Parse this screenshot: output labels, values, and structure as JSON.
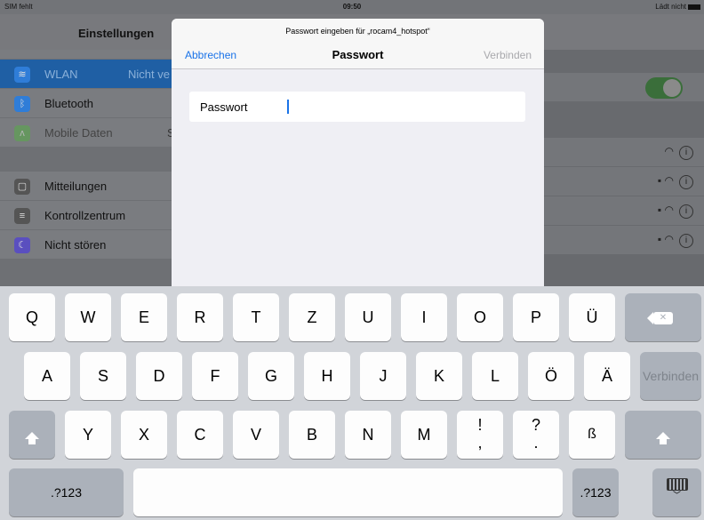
{
  "status_bar": {
    "carrier": "SIM fehlt",
    "time": "09:50",
    "battery_text": "Lädt nicht"
  },
  "settings": {
    "title": "Einstellungen",
    "items": [
      {
        "label": "WLAN",
        "value": "Nicht ve",
        "icon": "wifi-icon",
        "color": "#2f7dd8"
      },
      {
        "label": "Bluetooth",
        "value": "",
        "icon": "bluetooth-icon",
        "color": "#2f7dd8"
      },
      {
        "label": "Mobile Daten",
        "value": "S",
        "icon": "antenna-icon",
        "color": "#5aa84c"
      },
      {
        "label": "Mitteilungen",
        "value": "",
        "icon": "notifications-icon",
        "color": "#666"
      },
      {
        "label": "Kontrollzentrum",
        "value": "",
        "icon": "control-center-icon",
        "color": "#666"
      },
      {
        "label": "Nicht stören",
        "value": "",
        "icon": "moon-icon",
        "color": "#5a4fbf"
      }
    ]
  },
  "dialog": {
    "prompt": "Passwort eingeben für „rocam4_hotspot“",
    "cancel_label": "Abbrechen",
    "title": "Passwort",
    "connect_label": "Verbinden",
    "field_label": "Passwort",
    "field_value": ""
  },
  "keyboard": {
    "row1": [
      "Q",
      "W",
      "E",
      "R",
      "T",
      "Z",
      "U",
      "I",
      "O",
      "P",
      "Ü"
    ],
    "row2": [
      "A",
      "S",
      "D",
      "F",
      "G",
      "H",
      "J",
      "K",
      "L",
      "Ö",
      "Ä"
    ],
    "row3": [
      "Y",
      "X",
      "C",
      "V",
      "B",
      "N",
      "M"
    ],
    "row3_punct": [
      [
        "!",
        ","
      ],
      [
        "?",
        "."
      ]
    ],
    "row3_extra": "ß",
    "return_label": "Verbinden",
    "numbers_label": ".?123",
    "keyboard_icon": "keyboard-dismiss-icon",
    "delete_icon": "delete-icon",
    "shift_icon": "shift-icon"
  }
}
